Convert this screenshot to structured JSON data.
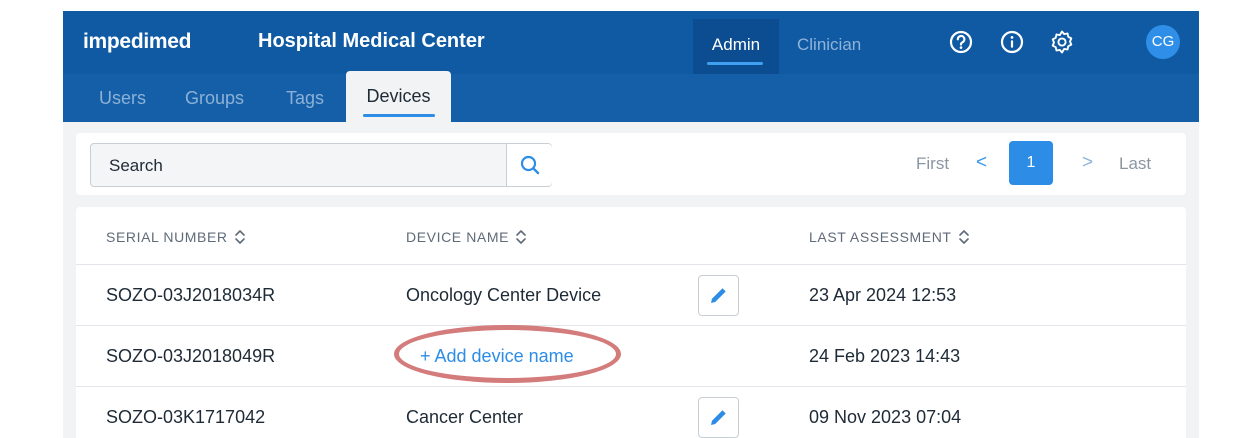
{
  "header": {
    "brand": "impedimed",
    "organization": "Hospital Medical Center",
    "tabs": [
      {
        "label": "Admin",
        "active": true
      },
      {
        "label": "Clinician",
        "active": false
      }
    ],
    "icons": [
      "help-icon",
      "info-icon",
      "settings-icon"
    ],
    "avatar_initials": "CG"
  },
  "subnav": {
    "items": [
      {
        "label": "Users",
        "active": false
      },
      {
        "label": "Groups",
        "active": false
      },
      {
        "label": "Tags",
        "active": false
      },
      {
        "label": "Devices",
        "active": true
      }
    ]
  },
  "search": {
    "placeholder": "Search"
  },
  "pagination": {
    "first": "First",
    "prev": "<",
    "current": "1",
    "next": ">",
    "last": "Last"
  },
  "table": {
    "columns": [
      "SERIAL NUMBER",
      "DEVICE NAME",
      "LAST ASSESSMENT"
    ],
    "rows": [
      {
        "serial": "SOZO-03J2018034R",
        "name": "Oncology Center Device",
        "last": "23 Apr 2024 12:53"
      },
      {
        "serial": "SOZO-03J2018049R",
        "add_label": "+ Add device name",
        "last": "24 Feb 2023 14:43"
      },
      {
        "serial": "SOZO-03K1717042",
        "name": "Cancer Center",
        "last": "09 Nov 2023 07:04"
      }
    ]
  },
  "colors": {
    "header_bg": "#0f5aa3",
    "subnav_bg": "#155fa8",
    "accent": "#2d8ce6",
    "highlight_circle": "#cf6e6e"
  }
}
